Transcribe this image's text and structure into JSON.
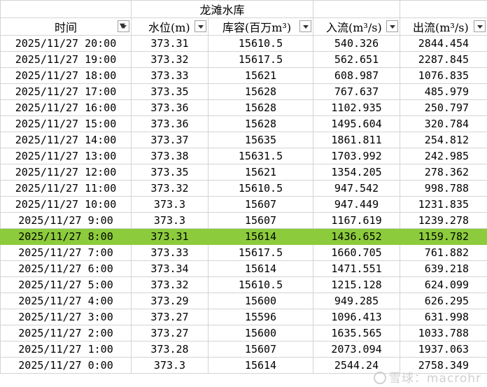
{
  "title": "龙滩水库",
  "headers": [
    "时间",
    "水位(m)",
    "库容(百万m³)",
    "入流(m³/s)",
    "出流(m³/s)"
  ],
  "selected_row_index": 12,
  "selected_row_color": "#8ccc3c",
  "icons": {
    "time_header": "filter-active-icon",
    "others": "dropdown-arrow-icon"
  },
  "rows": [
    [
      "2025/11/27 20:00",
      "373.31",
      "15610.5",
      "540.326",
      "2844.454"
    ],
    [
      "2025/11/27 19:00",
      "373.32",
      "15617.5",
      "562.651",
      "2287.845"
    ],
    [
      "2025/11/27 18:00",
      "373.33",
      "15621",
      "608.987",
      "1076.835"
    ],
    [
      "2025/11/27 17:00",
      "373.35",
      "15628",
      "767.637",
      "485.979"
    ],
    [
      "2025/11/27 16:00",
      "373.36",
      "15628",
      "1102.935",
      "250.797"
    ],
    [
      "2025/11/27 15:00",
      "373.36",
      "15628",
      "1495.604",
      "320.784"
    ],
    [
      "2025/11/27 14:00",
      "373.37",
      "15635",
      "1861.811",
      "254.812"
    ],
    [
      "2025/11/27 13:00",
      "373.38",
      "15631.5",
      "1703.992",
      "242.985"
    ],
    [
      "2025/11/27 12:00",
      "373.35",
      "15621",
      "1354.205",
      "278.362"
    ],
    [
      "2025/11/27 11:00",
      "373.32",
      "15610.5",
      "947.542",
      "998.788"
    ],
    [
      "2025/11/27 10:00",
      "373.3",
      "15607",
      "947.449",
      "1231.835"
    ],
    [
      "2025/11/27 9:00",
      "373.3",
      "15607",
      "1167.619",
      "1239.278"
    ],
    [
      "2025/11/27 8:00",
      "373.31",
      "15614",
      "1436.652",
      "1159.782"
    ],
    [
      "2025/11/27 7:00",
      "373.33",
      "15617.5",
      "1660.705",
      "761.882"
    ],
    [
      "2025/11/27 6:00",
      "373.34",
      "15614",
      "1471.551",
      "639.218"
    ],
    [
      "2025/11/27 5:00",
      "373.32",
      "15610.5",
      "1215.128",
      "624.099"
    ],
    [
      "2025/11/27 4:00",
      "373.29",
      "15600",
      "949.285",
      "626.295"
    ],
    [
      "2025/11/27 3:00",
      "373.27",
      "15596",
      "1096.413",
      "631.998"
    ],
    [
      "2025/11/27 2:00",
      "373.27",
      "15600",
      "1635.565",
      "1033.788"
    ],
    [
      "2025/11/27 1:00",
      "373.28",
      "15607",
      "2073.094",
      "1937.063"
    ],
    [
      "2025/11/27 0:00",
      "373.3",
      "15614",
      "2544.24",
      "2758.349"
    ]
  ],
  "watermark": "雪球：macrohr"
}
